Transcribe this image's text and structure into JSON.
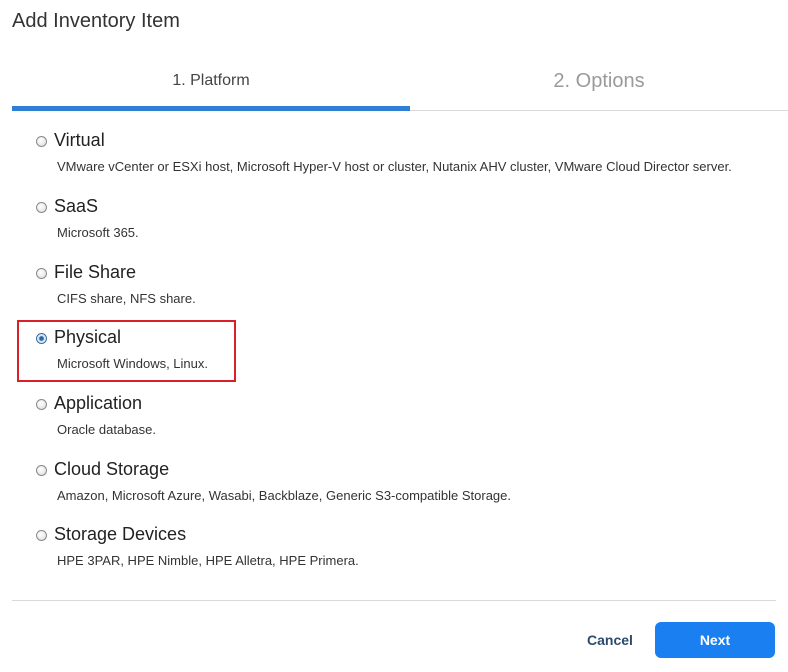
{
  "dialog": {
    "title": "Add Inventory Item"
  },
  "tabs": [
    {
      "label": "1. Platform",
      "active": true
    },
    {
      "label": "2. Options",
      "active": false
    }
  ],
  "platform_options": [
    {
      "label": "Virtual",
      "description": "VMware vCenter or ESXi host, Microsoft Hyper-V host or cluster, Nutanix AHV cluster, VMware Cloud Director server.",
      "selected": false
    },
    {
      "label": "SaaS",
      "description": "Microsoft 365.",
      "selected": false
    },
    {
      "label": "File Share",
      "description": "CIFS share, NFS share.",
      "selected": false
    },
    {
      "label": "Physical",
      "description": "Microsoft Windows, Linux.",
      "selected": true
    },
    {
      "label": "Application",
      "description": "Oracle database.",
      "selected": false
    },
    {
      "label": "Cloud Storage",
      "description": "Amazon, Microsoft Azure, Wasabi, Backblaze, Generic S3-compatible Storage.",
      "selected": false
    },
    {
      "label": "Storage Devices",
      "description": "HPE 3PAR, HPE Nimble, HPE Alletra, HPE Primera.",
      "selected": false
    }
  ],
  "footer": {
    "cancel_label": "Cancel",
    "next_label": "Next"
  },
  "colors": {
    "accent": "#1a7ff0",
    "tab_underline": "#2f7fd5",
    "highlight": "#d8202a"
  }
}
